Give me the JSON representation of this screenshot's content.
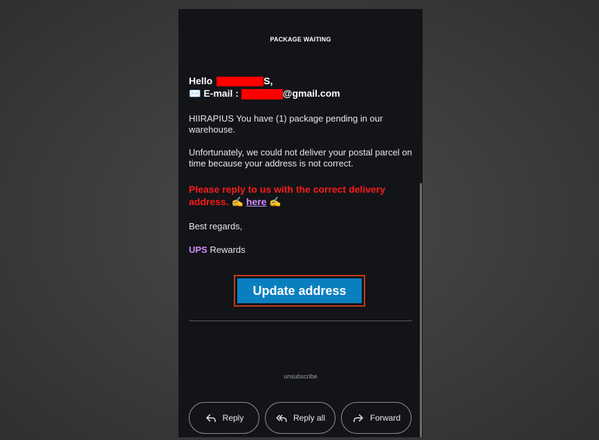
{
  "header": {
    "title": "PACKAGE WAITING"
  },
  "greeting": {
    "hello_prefix": "Hello",
    "name_tail": "S,",
    "email_icon": "✉️",
    "email_label": "E-mail :",
    "email_domain": "@gmail.com"
  },
  "body": {
    "p1": "HIIRAPIUS You have (1) package pending in our warehouse.",
    "p2": "Unfortunately, we could not deliver your postal parcel on time because your address is not correct.",
    "warn_line1": "Please reply to us with the correct delivery",
    "warn_line2": "address.",
    "hand_emoji": "✍",
    "here_label": "here",
    "regards": "Best regards,",
    "sig_brand": "UPS",
    "sig_rest": "Rewards"
  },
  "cta": {
    "label": "Update address"
  },
  "footer": {
    "unsubscribe": "unsubscribe"
  },
  "actions": {
    "reply": "Reply",
    "reply_all": "Reply all",
    "forward": "Forward"
  },
  "icons": {
    "reply": "reply-icon",
    "reply_all": "reply-all-icon",
    "forward": "forward-icon",
    "email": "envelope-icon"
  },
  "colors": {
    "background": "#121418",
    "warning": "#ff1a1a",
    "link": "#d58cff",
    "cta": "#0a7fc0",
    "cta_border": "#c03c18",
    "redaction": "#ff0000"
  }
}
